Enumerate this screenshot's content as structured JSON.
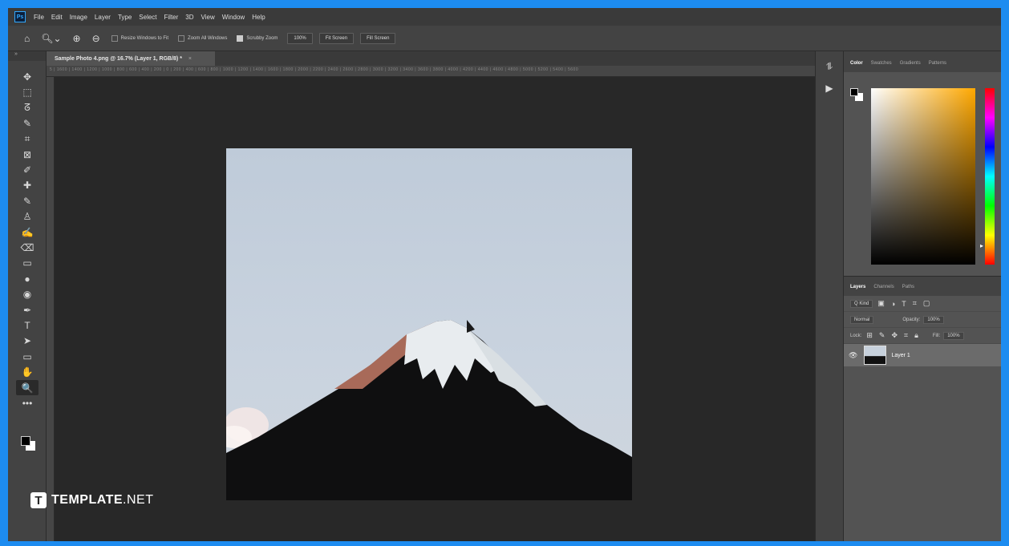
{
  "app": {
    "logo": "Ps"
  },
  "menu": [
    "File",
    "Edit",
    "Image",
    "Layer",
    "Type",
    "Select",
    "Filter",
    "3D",
    "View",
    "Window",
    "Help"
  ],
  "options": {
    "home_icon": "home-icon",
    "resize_windows_label": "Resize Windows to Fit",
    "zoom_all_label": "Zoom All Windows",
    "scrubby_zoom_label": "Scrubby Zoom",
    "zoom_100": "100%",
    "fit_screen": "Fit Screen",
    "fill_screen": "Fill Screen"
  },
  "document": {
    "tab_title": "Sample Photo 4.png @ 16.7% (Layer 1, RGB/8) *",
    "close": "×",
    "ruler_text": "5 | 1600 | 1400 | 1200 | 1000 | 800 | 600 | 400 | 200 | 0 | 200 | 400 | 600 | 800 | 1000 | 1200 | 1400 | 1600 | 1800 | 2000 | 2200 | 2400 | 2600 | 2800 | 3000 | 3200 | 3400 | 3600 | 3800 | 4000 | 4200 | 4400 | 4600 | 4800 | 5000 | 5200 | 5400 | 5600"
  },
  "toolbar": {
    "collapse": "»",
    "tools": [
      "move-icon",
      "marquee-icon",
      "lasso-icon",
      "magic-wand-icon",
      "crop-icon",
      "frame-icon",
      "eyedropper-icon",
      "healing-icon",
      "brush-icon",
      "stamp-icon",
      "history-brush-icon",
      "eraser-icon",
      "gradient-icon",
      "blur-icon",
      "dodge-icon",
      "pen-icon",
      "type-icon",
      "path-select-icon",
      "rectangle-icon",
      "hand-icon",
      "zoom-icon",
      "more-icon"
    ],
    "glyphs": [
      "✥",
      "⬚",
      "ᘔ",
      "✎",
      "⌗",
      "⊠",
      "✐",
      "✚",
      "✎",
      "♙",
      "✍",
      "⌫",
      "▭",
      "●",
      "◉",
      "✒",
      "T",
      "➤",
      "▭",
      "✋",
      "🔍",
      "•••"
    ]
  },
  "panels": {
    "color_tabs": [
      "Color",
      "Swatches",
      "Gradients",
      "Patterns"
    ],
    "layer_tabs": [
      "Layers",
      "Channels",
      "Paths"
    ],
    "kind_label": "Q Kind",
    "blend_mode": "Normal",
    "opacity_label": "Opacity:",
    "opacity_value": "100%",
    "lock_label": "Lock:",
    "fill_label": "Fill:",
    "fill_value": "100%",
    "layer_name": "Layer 1"
  },
  "watermark": {
    "logo": "T",
    "brand": "TEMPLATE",
    "suffix": ".NET"
  }
}
